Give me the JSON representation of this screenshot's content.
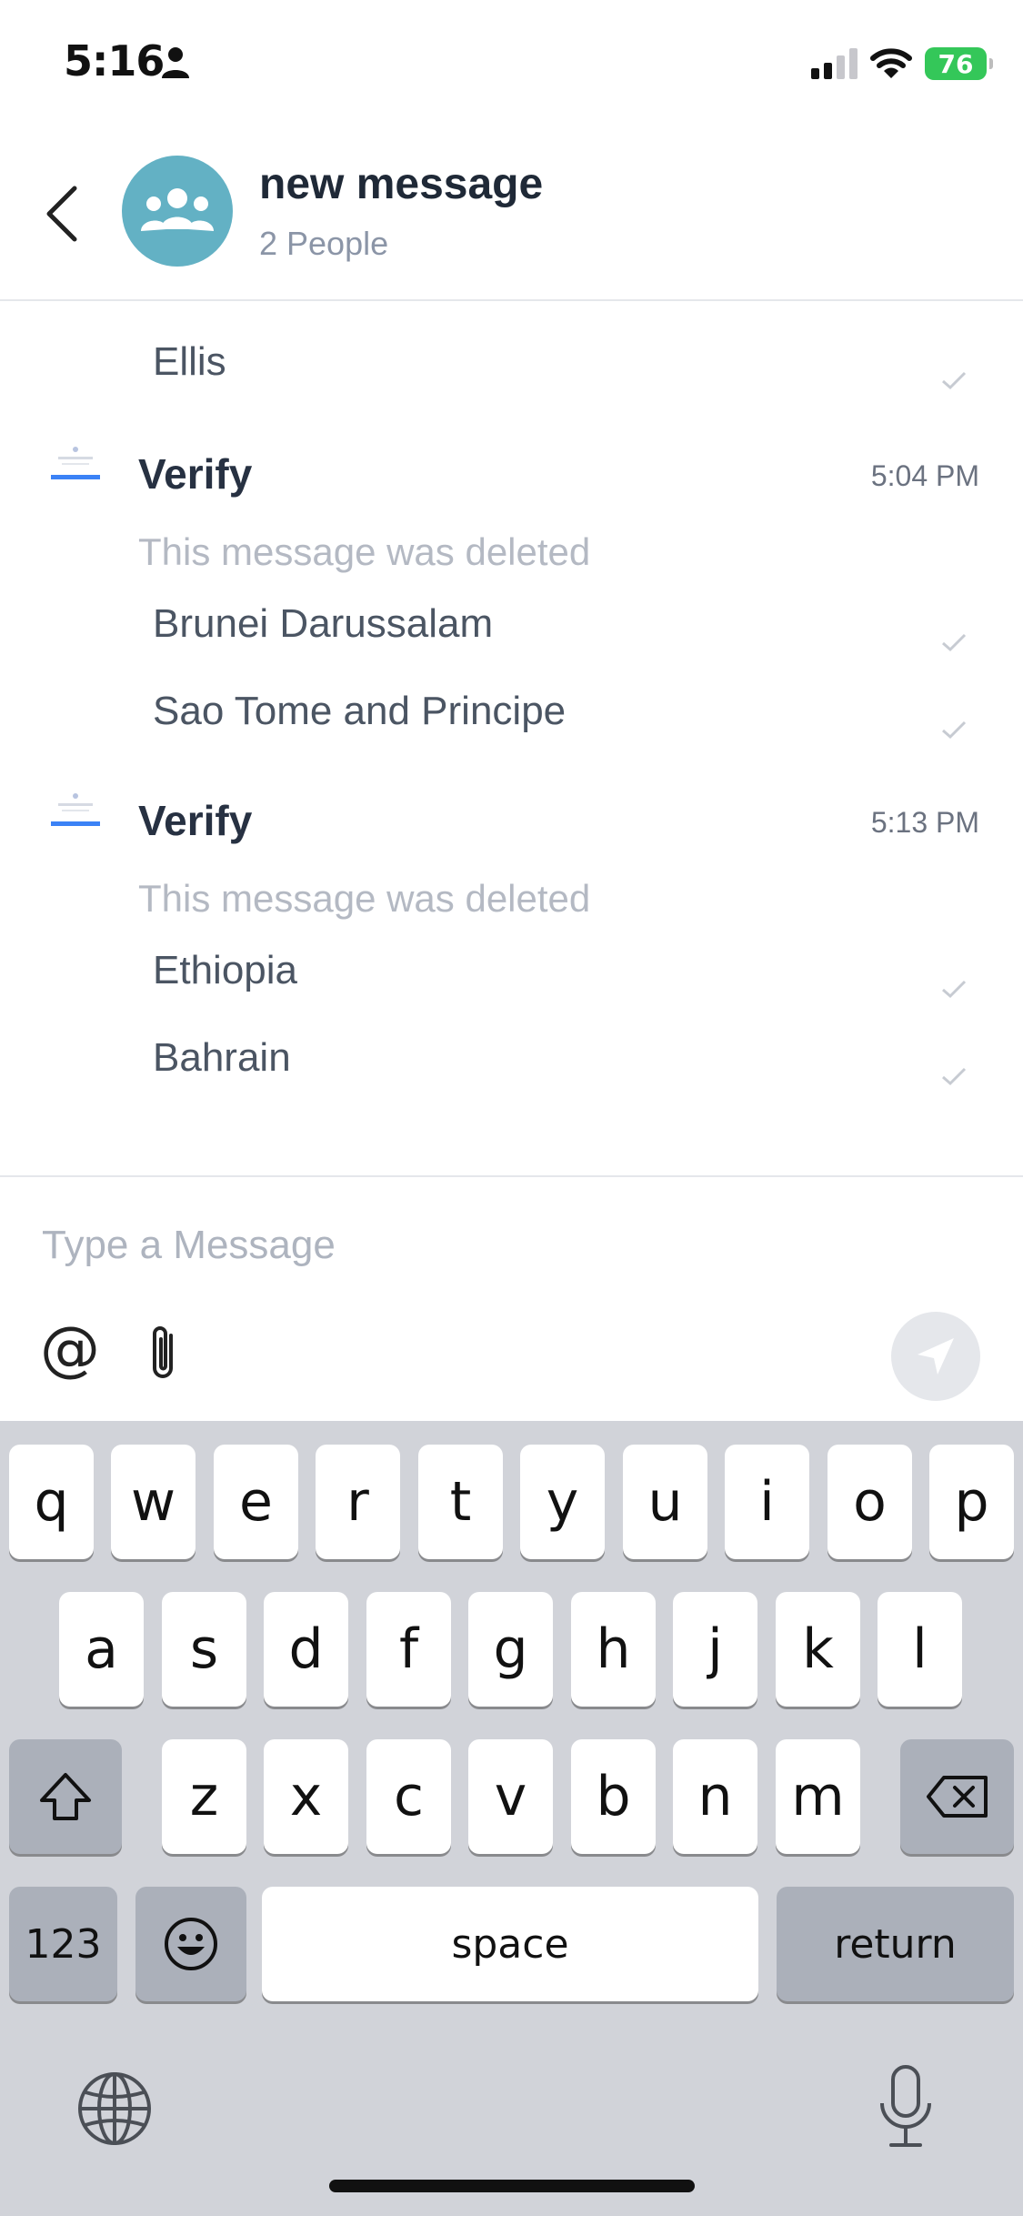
{
  "status_bar": {
    "time": "5:16",
    "battery": "76"
  },
  "header": {
    "title": "new message",
    "subtitle": "2 People"
  },
  "chat": {
    "items": [
      {
        "type": "option",
        "text": "Ellis"
      },
      {
        "type": "message",
        "sender": "Verify",
        "time": "5:04 PM",
        "body": "This message was deleted"
      },
      {
        "type": "option",
        "text": "Brunei Darussalam"
      },
      {
        "type": "option",
        "text": "Sao Tome and Principe"
      },
      {
        "type": "message",
        "sender": "Verify",
        "time": "5:13 PM",
        "body": "This message was deleted"
      },
      {
        "type": "option",
        "text": "Ethiopia"
      },
      {
        "type": "option",
        "text": "Bahrain"
      }
    ]
  },
  "composer": {
    "placeholder": "Type a Message",
    "at_label": "@"
  },
  "keyboard": {
    "row1": [
      "q",
      "w",
      "e",
      "r",
      "t",
      "y",
      "u",
      "i",
      "o",
      "p"
    ],
    "row2": [
      "a",
      "s",
      "d",
      "f",
      "g",
      "h",
      "j",
      "k",
      "l"
    ],
    "row3": [
      "z",
      "x",
      "c",
      "v",
      "b",
      "n",
      "m"
    ],
    "numbers_label": "123",
    "space_label": "space",
    "return_label": "return"
  },
  "icons": {
    "back": "chevron-left-icon",
    "group": "group-icon",
    "attach": "paperclip-icon",
    "send": "send-icon",
    "shift": "shift-icon",
    "delete": "backspace-icon",
    "emoji": "emoji-icon",
    "globe": "globe-icon",
    "mic": "microphone-icon"
  },
  "colors": {
    "avatar": "#63b1c4",
    "battery": "#34c759",
    "keyboard_bg": "#d1d3d9"
  }
}
